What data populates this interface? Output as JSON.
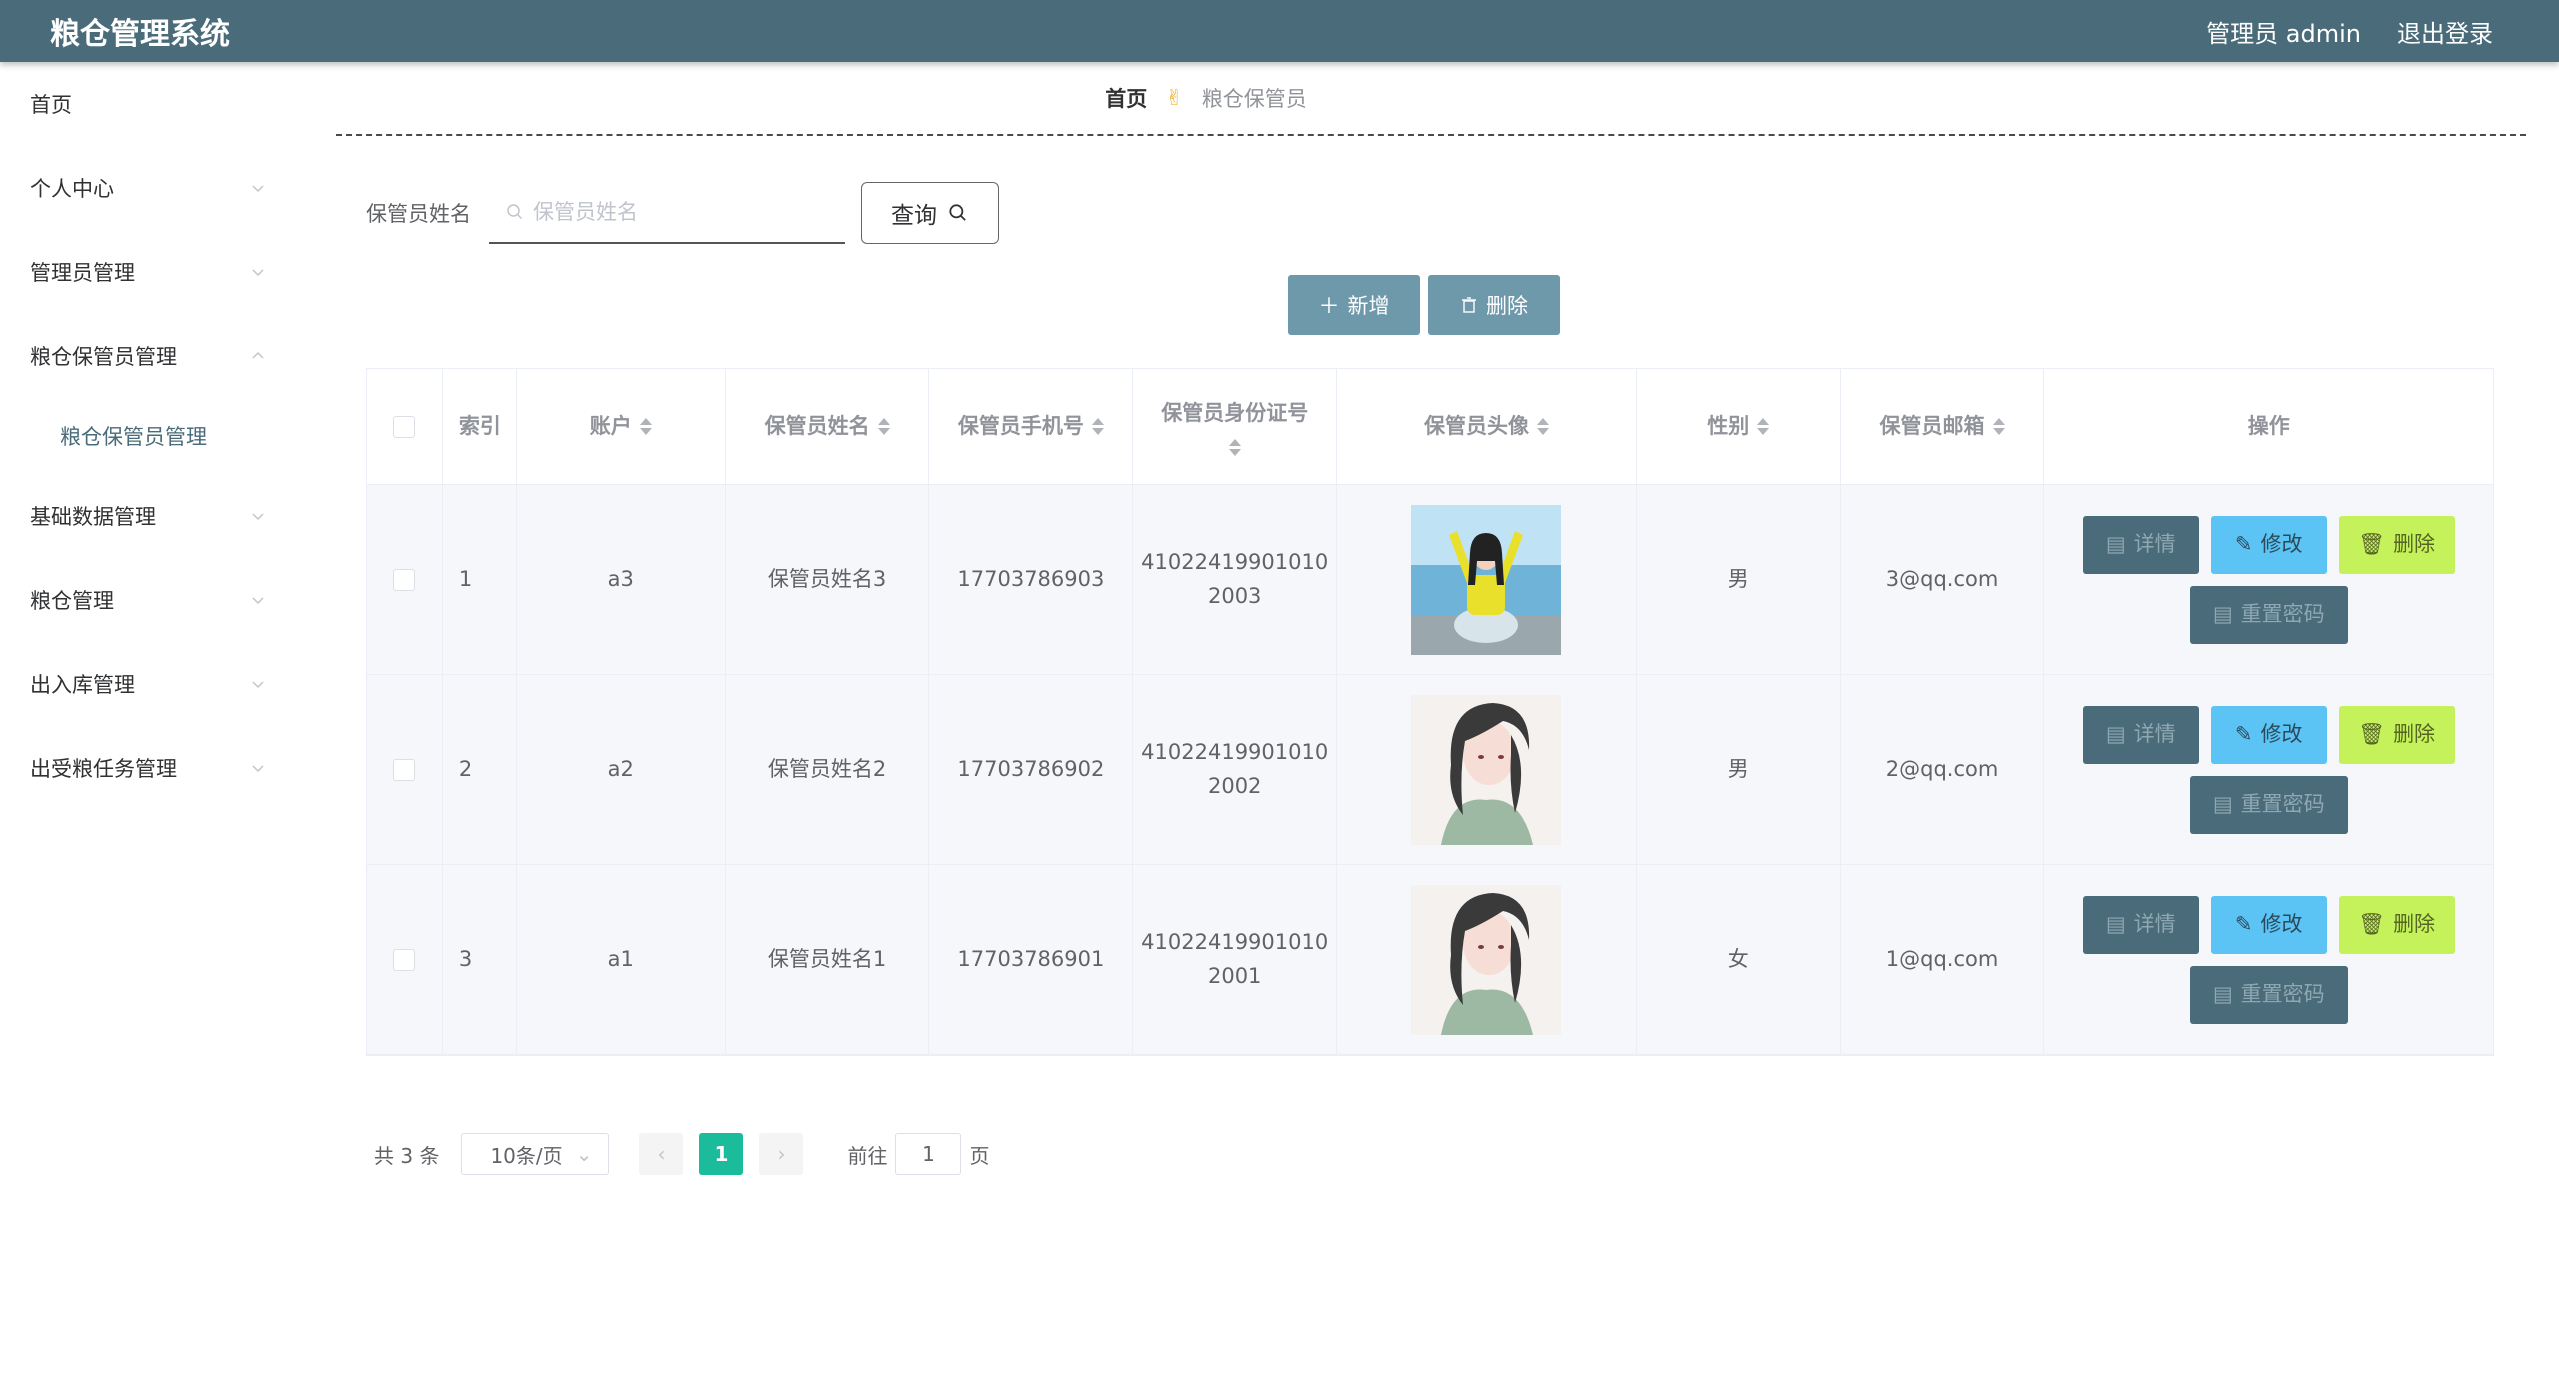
{
  "header": {
    "title": "粮仓管理系统",
    "user": "管理员 admin",
    "logout": "退出登录"
  },
  "sidebar": {
    "items": [
      {
        "label": "首页",
        "chevron": false
      },
      {
        "label": "个人中心",
        "chevron": true
      },
      {
        "label": "管理员管理",
        "chevron": true
      },
      {
        "label": "粮仓保管员管理",
        "chevron": true,
        "expanded": true
      },
      {
        "label": "基础数据管理",
        "chevron": true
      },
      {
        "label": "粮仓管理",
        "chevron": true
      },
      {
        "label": "出入库管理",
        "chevron": true
      },
      {
        "label": "出受粮任务管理",
        "chevron": true
      }
    ],
    "subitem": "粮仓保管员管理"
  },
  "breadcrumb": {
    "home": "首页",
    "current": "粮仓保管员"
  },
  "search": {
    "label": "保管员姓名",
    "placeholder": "保管员姓名",
    "value": "",
    "button": "查询"
  },
  "actions": {
    "add": "新增",
    "delete": "删除"
  },
  "table": {
    "headers": [
      "索引",
      "账户",
      "保管员姓名",
      "保管员手机号",
      "保管员身份证号",
      "保管员头像",
      "性别",
      "保管员邮箱",
      "操作"
    ],
    "rows": [
      {
        "index": "1",
        "account": "a3",
        "name": "保管员姓名3",
        "phone": "17703786903",
        "id_line1": "41022419901010",
        "id_line2": "2003",
        "avatar": "beach-girl-photo",
        "gender": "男",
        "email": "3@qq.com"
      },
      {
        "index": "2",
        "account": "a2",
        "name": "保管员姓名2",
        "phone": "17703786902",
        "id_line1": "41022419901010",
        "id_line2": "2002",
        "avatar": "anime-girl-illustration",
        "gender": "男",
        "email": "2@qq.com"
      },
      {
        "index": "3",
        "account": "a1",
        "name": "保管员姓名1",
        "phone": "17703786901",
        "id_line1": "41022419901010",
        "id_line2": "2001",
        "avatar": "anime-girl-illustration",
        "gender": "女",
        "email": "1@qq.com"
      }
    ],
    "ops": {
      "detail": "详情",
      "edit": "修改",
      "delete": "删除",
      "reset": "重置密码"
    }
  },
  "pagination": {
    "total": "共 3 条",
    "page_size": "10条/页",
    "current_page": "1",
    "goto_label": "前往",
    "goto_value": "1",
    "page_suffix": "页"
  },
  "colors": {
    "header": "#4a6b7a",
    "accent": "#1abc9c",
    "edit": "#5cc4f5",
    "delete": "#c5f25a"
  }
}
